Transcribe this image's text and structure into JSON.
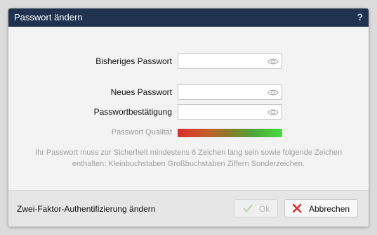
{
  "dialog": {
    "title": "Passwort ändern",
    "help_icon": "?"
  },
  "fields": {
    "current_password": {
      "label": "Bisheriges Passwort",
      "value": "",
      "placeholder": "",
      "icon": "eye-icon"
    },
    "new_password": {
      "label": "Neues Passwort",
      "value": "",
      "placeholder": "",
      "icon": "eye-icon"
    },
    "confirm_password": {
      "label": "Passwortbestätigung",
      "value": "",
      "placeholder": "",
      "icon": "eye-icon"
    }
  },
  "quality": {
    "label": "Passwort Qualität",
    "colors": [
      "#d6302a",
      "#8d7a2c",
      "#46dc3a"
    ]
  },
  "hint": "Ihr Passwort muss zur Sicherheit mindestens 8 Zeichen lang sein sowie folgende Zeichen enthalten: Kleinbuchstaben Großbuchstaben Ziffern Sonderzeichen.",
  "footer": {
    "twofa_link": "Zwei-Faktor-Authentifizierung ändern",
    "ok_label": "Ok",
    "ok_icon": "check-icon",
    "ok_enabled": false,
    "cancel_label": "Abbrechen",
    "cancel_icon": "x-icon"
  },
  "colors": {
    "titlebar": "#1f3350",
    "body": "#f3f3f3",
    "footer": "#e6e6e6",
    "cancel_icon": "#d52b2b",
    "ok_icon_disabled": "#b8d8a8"
  }
}
